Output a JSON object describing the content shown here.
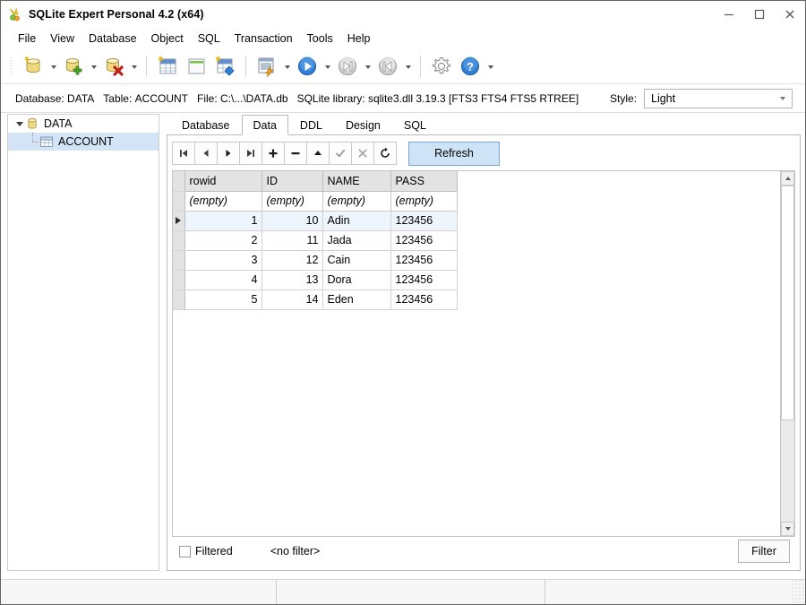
{
  "window": {
    "title": "SQLite Expert Personal 4.2 (x64)",
    "app_icon": "butterfly-icon",
    "minimize": "–",
    "maximize": "□",
    "close": "✕"
  },
  "menu": {
    "items": [
      {
        "label": "File"
      },
      {
        "label": "View"
      },
      {
        "label": "Database"
      },
      {
        "label": "Object"
      },
      {
        "label": "SQL"
      },
      {
        "label": "Transaction"
      },
      {
        "label": "Tools"
      },
      {
        "label": "Help"
      }
    ]
  },
  "toolbar": {
    "buttons": [
      {
        "name": "open-database",
        "icon": "database-icon",
        "dropdown": true
      },
      {
        "name": "new-database",
        "icon": "database-add-icon",
        "dropdown": true
      },
      {
        "name": "delete-database",
        "icon": "database-delete-icon",
        "dropdown": true
      },
      {
        "name": "new-table",
        "icon": "table-new-icon",
        "dropdown": false
      },
      {
        "name": "new-view",
        "icon": "view-new-icon",
        "dropdown": false
      },
      {
        "name": "new-index",
        "icon": "index-new-icon",
        "dropdown": false
      },
      {
        "name": "execute-sql",
        "icon": "sql-execute-icon",
        "dropdown": true
      },
      {
        "name": "run",
        "icon": "play-icon",
        "dropdown": true
      },
      {
        "name": "step-forward",
        "icon": "next-icon",
        "dropdown": true
      },
      {
        "name": "step-back",
        "icon": "prev-icon",
        "dropdown": true
      },
      {
        "name": "options",
        "icon": "gear-icon",
        "dropdown": false
      },
      {
        "name": "help",
        "icon": "help-icon",
        "dropdown": true
      }
    ]
  },
  "infobar": {
    "database_label": "Database:",
    "database_value": "DATA",
    "table_label": "Table:",
    "table_value": "ACCOUNT",
    "file_label": "File:",
    "file_value": "C:\\...\\DATA.db",
    "library_label": "SQLite library:",
    "library_value": "sqlite3.dll 3.19.3 [FTS3 FTS4 FTS5 RTREE]",
    "style_label": "Style:",
    "style_value": "Light"
  },
  "tree": {
    "nodes": [
      {
        "label": "DATA",
        "icon": "database-icon",
        "level": 0,
        "expanded": true,
        "selected": false
      },
      {
        "label": "ACCOUNT",
        "icon": "table-icon",
        "level": 1,
        "expanded": false,
        "selected": true
      }
    ]
  },
  "tabs": {
    "items": [
      {
        "label": "Database",
        "active": false
      },
      {
        "label": "Data",
        "active": true
      },
      {
        "label": "DDL",
        "active": false
      },
      {
        "label": "Design",
        "active": false
      },
      {
        "label": "SQL",
        "active": false
      }
    ]
  },
  "navigator": {
    "buttons": [
      {
        "name": "first-record-button",
        "icon": "first-icon"
      },
      {
        "name": "prior-record-button",
        "icon": "prev-icon"
      },
      {
        "name": "next-record-button",
        "icon": "next-icon"
      },
      {
        "name": "last-record-button",
        "icon": "last-icon"
      },
      {
        "name": "insert-record-button",
        "icon": "plus-icon"
      },
      {
        "name": "delete-record-button",
        "icon": "minus-icon"
      },
      {
        "name": "edit-record-button",
        "icon": "caret-up-icon"
      },
      {
        "name": "post-edit-button",
        "icon": "check-icon"
      },
      {
        "name": "cancel-edit-button",
        "icon": "close-icon"
      },
      {
        "name": "refresh-record-button",
        "icon": "reload-icon"
      }
    ],
    "refresh_label": "Refresh"
  },
  "grid": {
    "columns": [
      "rowid",
      "ID",
      "NAME",
      "PASS"
    ],
    "filter_row": [
      "(empty)",
      "(empty)",
      "(empty)",
      "(empty)"
    ],
    "rows": [
      {
        "rowid": "1",
        "ID": "10",
        "NAME": "Adin",
        "PASS": "123456",
        "current": true
      },
      {
        "rowid": "2",
        "ID": "11",
        "NAME": "Jada",
        "PASS": "123456",
        "current": false
      },
      {
        "rowid": "3",
        "ID": "12",
        "NAME": "Cain",
        "PASS": "123456",
        "current": false
      },
      {
        "rowid": "4",
        "ID": "13",
        "NAME": "Dora",
        "PASS": "123456",
        "current": false
      },
      {
        "rowid": "5",
        "ID": "14",
        "NAME": "Eden",
        "PASS": "123456",
        "current": false
      }
    ]
  },
  "footer": {
    "filtered_label": "Filtered",
    "filtered_checked": false,
    "filter_text": "<no filter>",
    "filter_button": "Filter"
  },
  "colors": {
    "selection": "#d4e4f7",
    "current_row": "#eff5fd",
    "accent": "#7aa7d0",
    "refresh_bg": "#cfe3f7",
    "header_bg": "#e3e3e3"
  }
}
